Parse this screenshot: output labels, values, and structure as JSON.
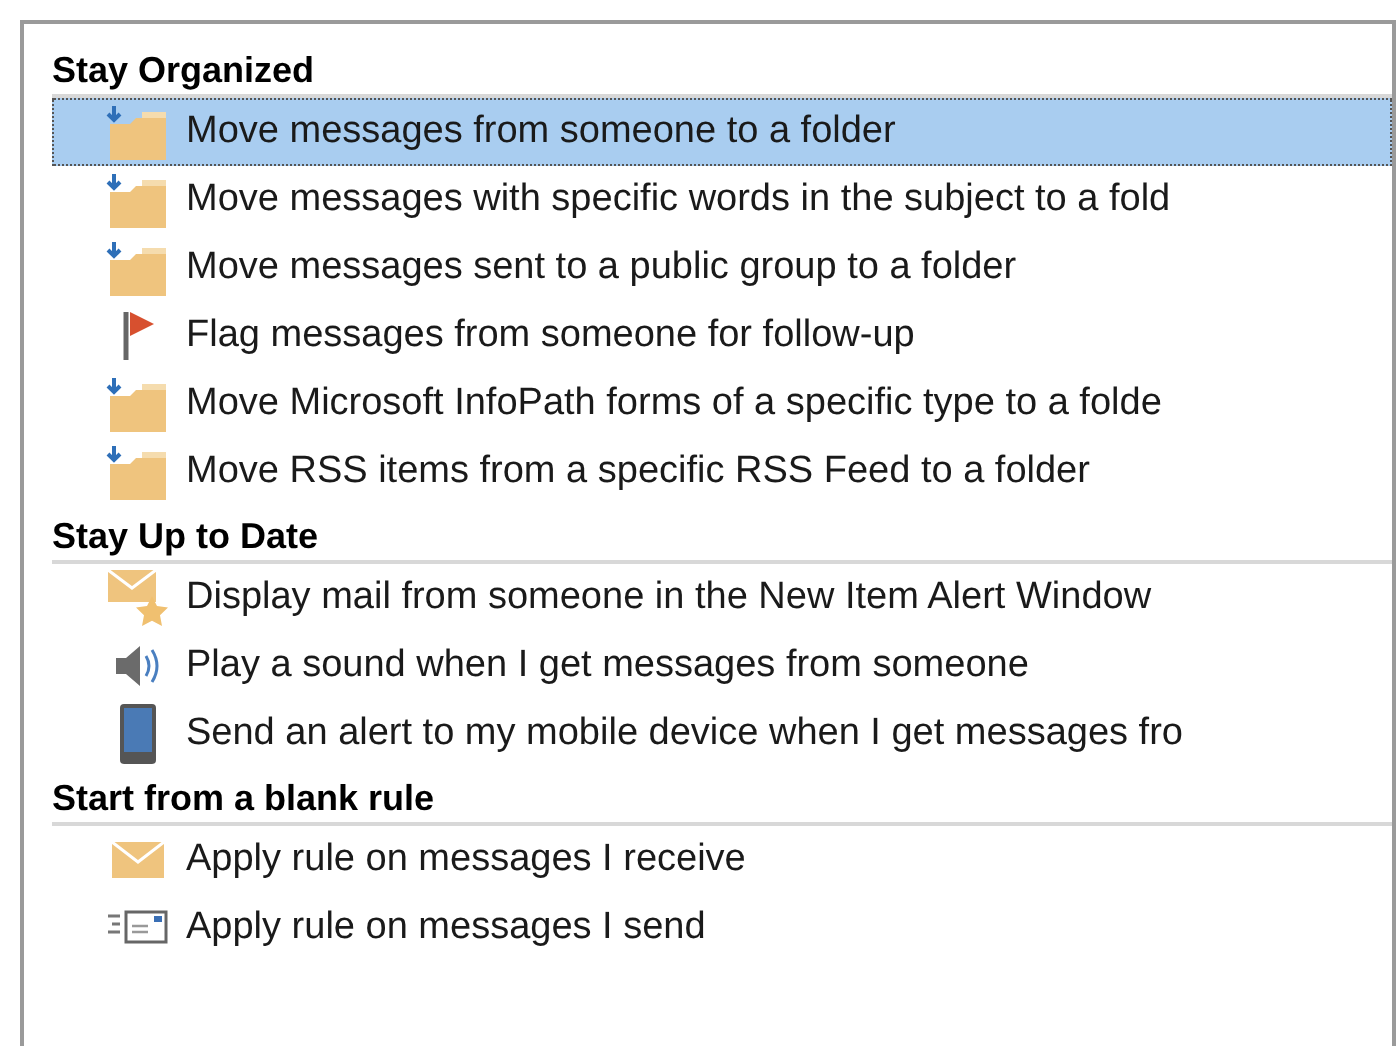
{
  "groups": [
    {
      "heading": "Stay Organized",
      "items": [
        {
          "kind": "move",
          "label": "Move messages from someone to a folder",
          "selected": true
        },
        {
          "kind": "move",
          "label": "Move messages with specific words in the subject to a fold",
          "selected": false
        },
        {
          "kind": "move",
          "label": "Move messages sent to a public group to a folder",
          "selected": false
        },
        {
          "kind": "flag",
          "label": "Flag messages from someone for follow-up",
          "selected": false
        },
        {
          "kind": "move",
          "label": "Move Microsoft InfoPath forms of a specific type to a folde",
          "selected": false
        },
        {
          "kind": "move",
          "label": "Move RSS items from a specific RSS Feed to a folder",
          "selected": false
        }
      ]
    },
    {
      "heading": "Stay Up to Date",
      "items": [
        {
          "kind": "alert",
          "label": "Display mail from someone in the New Item Alert Window",
          "selected": false
        },
        {
          "kind": "sound",
          "label": "Play a sound when I get messages from someone",
          "selected": false
        },
        {
          "kind": "mobile",
          "label": "Send an alert to my mobile device when I get messages fro",
          "selected": false
        }
      ]
    },
    {
      "heading": "Start from a blank rule",
      "items": [
        {
          "kind": "receive",
          "label": "Apply rule on messages I receive",
          "selected": false
        },
        {
          "kind": "send",
          "label": "Apply rule on messages I send",
          "selected": false
        }
      ]
    }
  ]
}
